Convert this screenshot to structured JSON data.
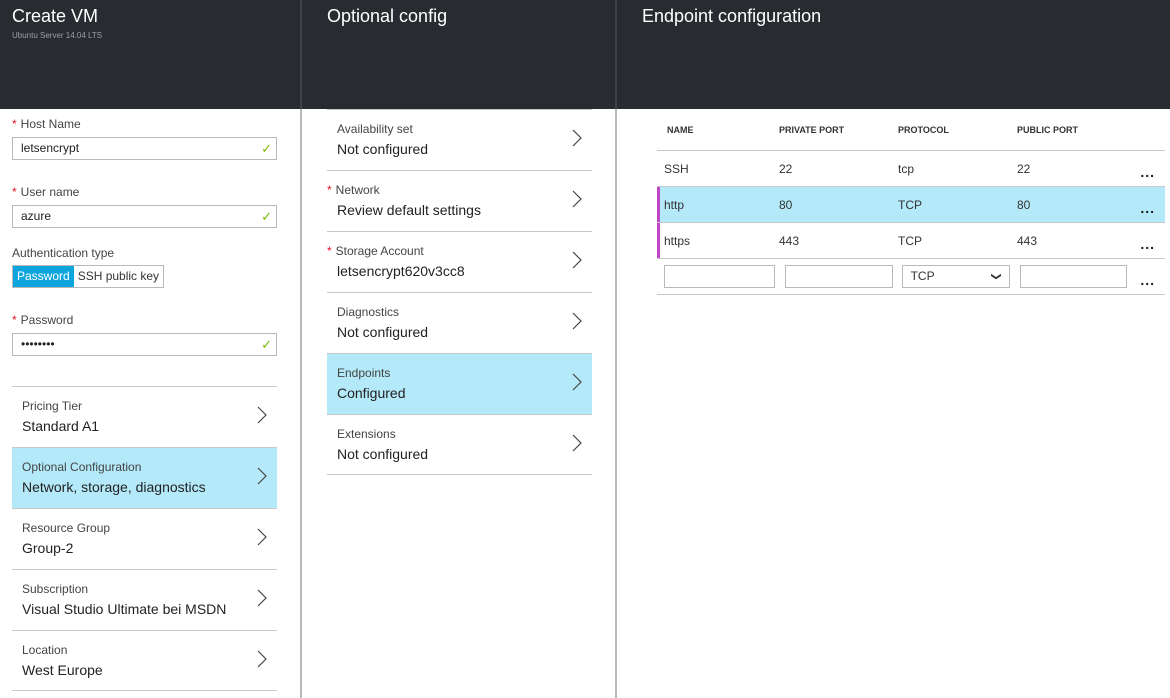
{
  "create_vm": {
    "title": "Create VM",
    "subtitle": "Ubuntu Server 14.04 LTS",
    "fields": {
      "host_name": {
        "label": "Host Name",
        "value": "letsencrypt",
        "required": true,
        "valid": true
      },
      "user_name": {
        "label": "User name",
        "value": "azure",
        "required": true,
        "valid": true
      },
      "auth_type": {
        "label": "Authentication type",
        "options": [
          "Password",
          "SSH public key"
        ],
        "selected": "Password"
      },
      "password": {
        "label": "Password",
        "value": "••••••••",
        "required": true,
        "valid": true
      }
    },
    "nav": [
      {
        "key": "Pricing Tier",
        "value": "Standard A1",
        "selected": false
      },
      {
        "key": "Optional Configuration",
        "value": "Network, storage, diagnostics",
        "selected": true
      },
      {
        "key": "Resource Group",
        "value": "Group-2",
        "selected": false
      },
      {
        "key": "Subscription",
        "value": "Visual Studio Ultimate bei MSDN",
        "selected": false
      },
      {
        "key": "Location",
        "value": "West Europe",
        "selected": false
      }
    ]
  },
  "optional_config": {
    "title": "Optional config",
    "items": [
      {
        "key": "Availability set",
        "value": "Not configured",
        "required": false,
        "selected": false
      },
      {
        "key": "Network",
        "value": "Review default settings",
        "required": true,
        "selected": false
      },
      {
        "key": "Storage Account",
        "value": "letsencrypt620v3cc8",
        "required": true,
        "selected": false
      },
      {
        "key": "Diagnostics",
        "value": "Not configured",
        "required": false,
        "selected": false
      },
      {
        "key": "Endpoints",
        "value": "Configured",
        "required": false,
        "selected": true
      },
      {
        "key": "Extensions",
        "value": "Not configured",
        "required": false,
        "selected": false
      }
    ]
  },
  "endpoint_config": {
    "title": "Endpoint configuration",
    "columns": [
      "NAME",
      "PRIVATE PORT",
      "PROTOCOL",
      "PUBLIC PORT"
    ],
    "rows": [
      {
        "name": "SSH",
        "private_port": "22",
        "protocol": "tcp",
        "public_port": "22"
      },
      {
        "name": "http",
        "private_port": "80",
        "protocol": "TCP",
        "public_port": "80"
      },
      {
        "name": "https",
        "private_port": "443",
        "protocol": "TCP",
        "public_port": "443"
      }
    ],
    "new_row": {
      "name": "",
      "private_port": "",
      "protocol": "TCP",
      "public_port": ""
    },
    "more_label": "..."
  },
  "colors": {
    "header_bg": "#282c31",
    "selected_bg": "#b3e9f8",
    "toggle_on": "#0ea5dd",
    "required": "#e81123",
    "valid_check": "#7ab800",
    "row_marker": "#c047c8"
  }
}
